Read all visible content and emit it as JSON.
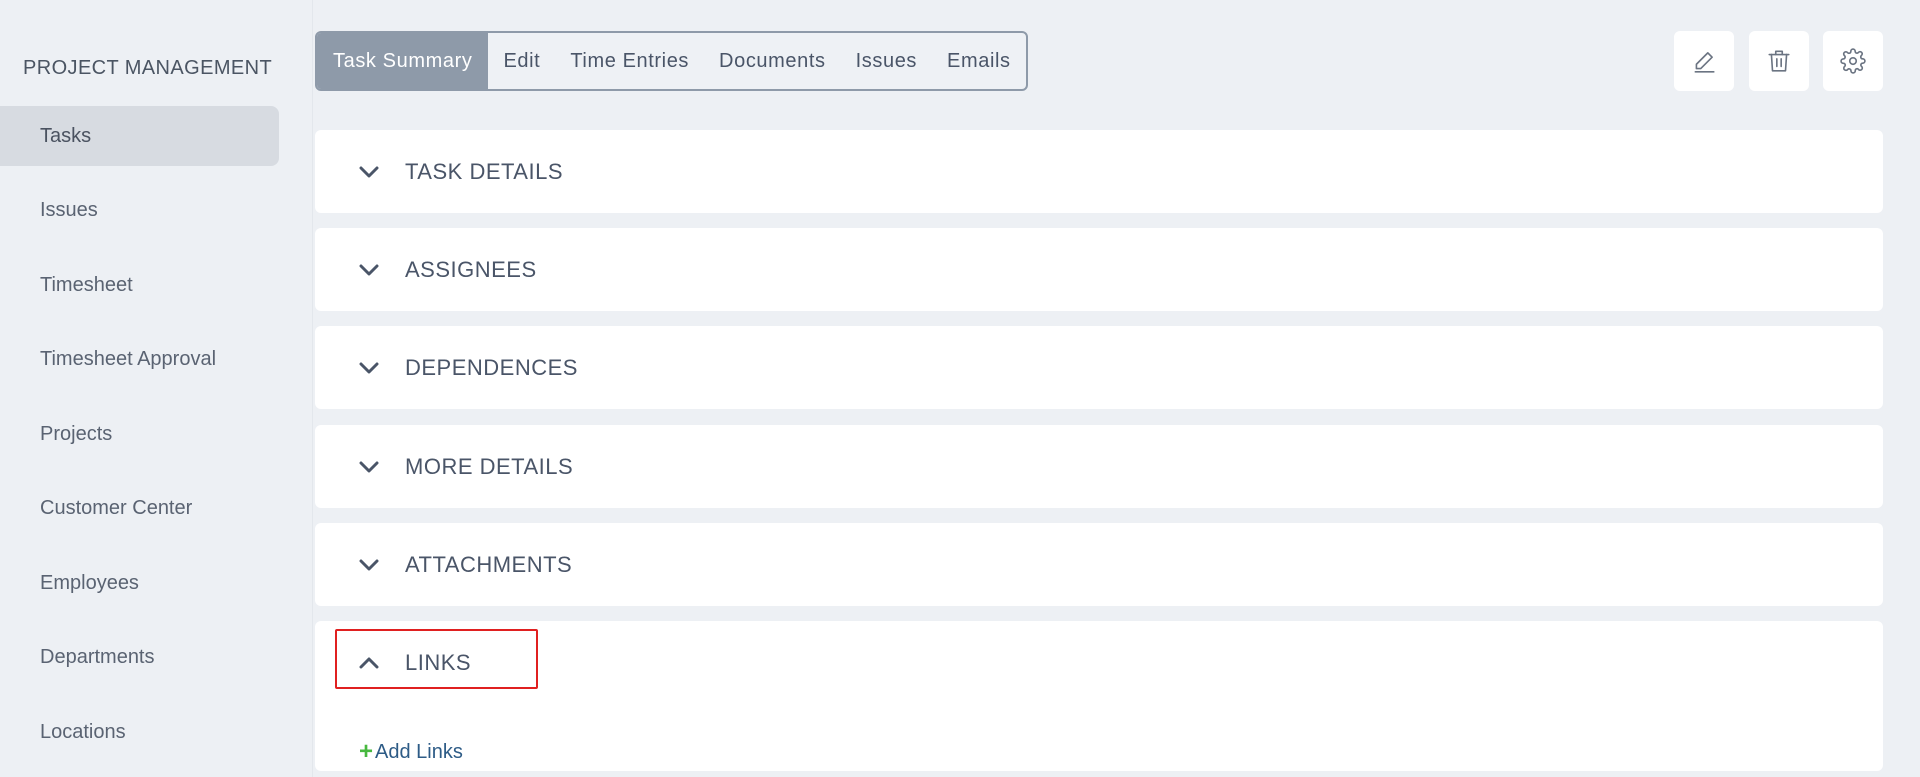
{
  "sidebar": {
    "title": "PROJECT MANAGEMENT",
    "items": [
      {
        "label": "Tasks",
        "active": true
      },
      {
        "label": "Issues"
      },
      {
        "label": "Timesheet"
      },
      {
        "label": "Timesheet Approval"
      },
      {
        "label": "Projects"
      },
      {
        "label": "Customer Center"
      },
      {
        "label": "Employees"
      },
      {
        "label": "Departments"
      },
      {
        "label": "Locations"
      }
    ]
  },
  "tabs": [
    {
      "label": "Task Summary",
      "active": true
    },
    {
      "label": "Edit"
    },
    {
      "label": "Time Entries"
    },
    {
      "label": "Documents"
    },
    {
      "label": "Issues"
    },
    {
      "label": "Emails"
    }
  ],
  "actions": {
    "edit_icon": "pencil-icon",
    "delete_icon": "trash-icon",
    "settings_icon": "gear-icon"
  },
  "sections": [
    {
      "title": "TASK DETAILS",
      "expanded": false
    },
    {
      "title": "ASSIGNEES",
      "expanded": false
    },
    {
      "title": "DEPENDENCES",
      "expanded": false
    },
    {
      "title": "MORE DETAILS",
      "expanded": false
    },
    {
      "title": "ATTACHMENTS",
      "expanded": false
    },
    {
      "title": "LINKS",
      "expanded": true
    }
  ],
  "links": {
    "add_label": "Add Links"
  },
  "colors": {
    "accent_tab": "#8e9aa9",
    "highlight_border": "#e02020",
    "add_plus": "#47b83f",
    "link_text": "#2d5b86"
  }
}
